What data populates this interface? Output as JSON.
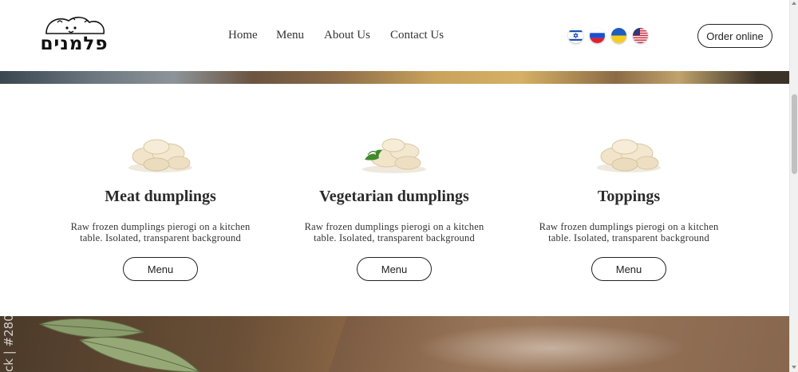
{
  "brand": {
    "logo_text": "פלמנים"
  },
  "nav": {
    "items": [
      {
        "label": "Home"
      },
      {
        "label": "Menu"
      },
      {
        "label": "About Us"
      },
      {
        "label": "Contact Us"
      }
    ]
  },
  "languages": [
    {
      "icon": "israel-flag-icon"
    },
    {
      "icon": "russia-flag-icon"
    },
    {
      "icon": "ukraine-flag-icon"
    },
    {
      "icon": "usa-flag-icon"
    }
  ],
  "order_button": {
    "label": "Order online"
  },
  "cards": [
    {
      "title": "Meat dumplings",
      "description_line1": "Raw frozen dumplings pierogi on a kitchen",
      "description_line2": "table. Isolated, transparent background",
      "button": "Menu",
      "icon": "dumplings-image"
    },
    {
      "title": "Vegetarian dumplings",
      "description_line1": "Raw frozen dumplings pierogi on a kitchen",
      "description_line2": "table. Isolated, transparent background",
      "button": "Menu",
      "icon": "dumplings-with-parsley-image"
    },
    {
      "title": "Toppings",
      "description_line1": "Raw frozen dumplings pierogi on a kitchen",
      "description_line2": "table. Isolated, transparent background",
      "button": "Menu",
      "icon": "dumplings-image"
    }
  ],
  "footer_photo": {
    "watermark": "ck | #280"
  },
  "colors": {
    "text": "#222222",
    "button_border": "#222222",
    "background": "#ffffff"
  }
}
